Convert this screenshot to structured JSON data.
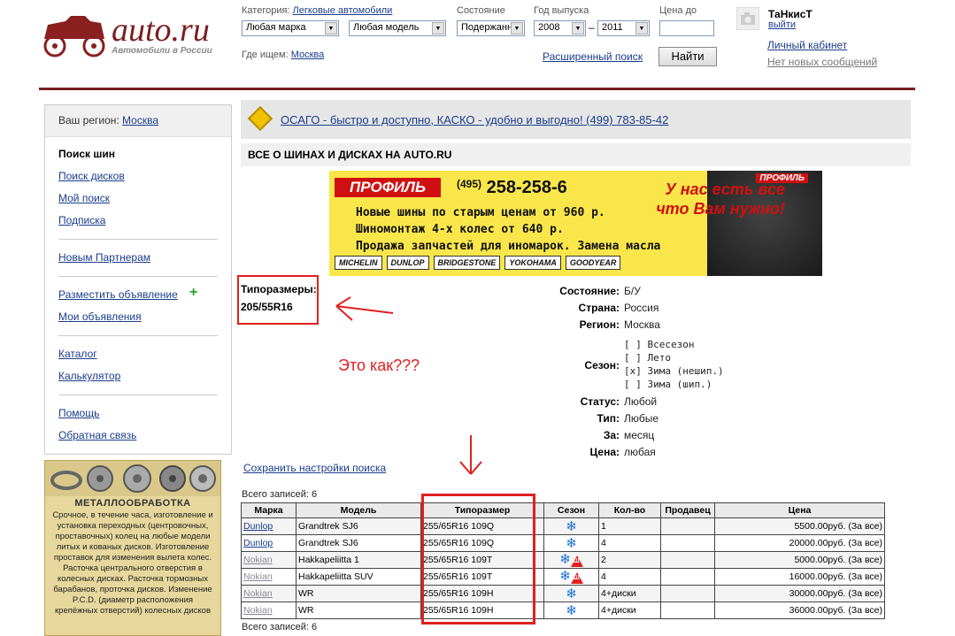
{
  "header": {
    "logo_text": "auto.ru",
    "logo_subtitle": "Автомобили в России",
    "category_label": "Категория:",
    "category_value": "Легковые автомобили",
    "make_value": "Любая марка",
    "model_value": "Любая модель",
    "condition_label": "Состояние",
    "condition_value": "Подержанн",
    "year_label": "Год выпуска",
    "year_from": "2008",
    "year_dash": "–",
    "year_to": "2011",
    "price_label": "Цена до",
    "price_value": "",
    "where_label": "Где ищем:",
    "where_value": "Москва",
    "advanced_search": "Расширенный поиск",
    "find_button": "Найти",
    "username": "ТаНкисТ",
    "logout": "выйти",
    "cabinet": "Личный кабинет",
    "messages": "Нет новых сообщений"
  },
  "sidebar": {
    "region_label": "Ваш регион:",
    "region_value": "Москва",
    "current_item": "Поиск шин",
    "items": [
      "Поиск дисков",
      "Мой поиск",
      "Подписка",
      "Новым Партнерам",
      "Разместить объявление",
      "Мои объявления",
      "Каталог",
      "Калькулятор",
      "Помощь",
      "Обратная связь"
    ],
    "plus": "+"
  },
  "ad_metal": {
    "title": "МЕТАЛЛООБРАБОТКА",
    "text": "Срочное, в течение часа, изготовление и установка переходных (центровочных, проставочных) колец на любые модели литых и кованых дисков. Изготовление проставок для изменения вылета колес. Расточка центрального отверстия в колесных дисках. Расточка тормозных барабанов, проточка дисков. Изменение P.C.D. (диаметр расположения крепёжных отверстий) колесных дисков"
  },
  "main": {
    "osago": "ОСАГО - быстро и доступно, КАСКО - удобно и выгодно! (499) 783-85-42",
    "section_title": "ВСЕ О ШИНАХ И ДИСКАХ НА AUTO.RU"
  },
  "banner": {
    "logo": "ПРОФИЛЬ",
    "logo2": "ПРОФИЛЬ",
    "phone_code": "(495)",
    "phone": "258-258-6",
    "slogan_1": "У нас есть все",
    "slogan_2": "что Вам нужно!",
    "line_1": "Новые шины по старым ценам от 960 р.",
    "line_2": "Шиномонтаж 4-х колес от 640 р.",
    "line_3": "Продажа запчастей для иномарок.  Замена масла",
    "brands": [
      "MICHELIN",
      "DUNLOP",
      "BRIDGESTONE",
      "YOKOHAMA",
      "GOODYEAR"
    ]
  },
  "annotations": {
    "tipo_label": "Типоразмеры:",
    "tipo_value": "205/55R16",
    "question": "Это как???"
  },
  "filters": {
    "condition_label": "Состояние:",
    "condition_value": "Б/У",
    "country_label": "Страна:",
    "country_value": "Россия",
    "region_label": "Регион:",
    "region_value": "Москва",
    "season_label": "Сезон:",
    "season_options": [
      "[ ] Всесезон",
      "[ ] Лето",
      "[x] Зима (нешип.)",
      "[ ] Зима (шип.)"
    ],
    "status_label": "Статус:",
    "status_value": "Любой",
    "type_label": "Тип:",
    "type_value": "Любые",
    "period_label": "За:",
    "period_value": "месяц",
    "price_label": "Цена:",
    "price_value": "любая",
    "save_link": "Сохранить настройки поиска"
  },
  "table": {
    "count_top": "Всего записей: 6",
    "count_bottom": "Всего записей: 6",
    "headers": [
      "Марка",
      "Модель",
      "Типоразмер",
      "Сезон",
      "Кол-во",
      "Продавец",
      "Цена"
    ],
    "rows": [
      {
        "make": "Dunlop",
        "model": "Grandtrek SJ6",
        "size": "255/65R16 109Q",
        "qty": "1",
        "seller": "",
        "price": "5500.00руб. (За все)",
        "studded": false
      },
      {
        "make": "Dunlop",
        "model": "Grandtrek SJ6",
        "size": "255/65R16 109Q",
        "qty": "4",
        "seller": "",
        "price": "20000.00руб. (За все)",
        "studded": false
      },
      {
        "make": "Nokian",
        "model": "Hakkapeliitta 1",
        "size": "255/65R16 109T",
        "qty": "2",
        "seller": "",
        "price": "5000.00руб. (За все)",
        "studded": true
      },
      {
        "make": "Nokian",
        "model": "Hakkapeliitta SUV",
        "size": "255/65R16 109T",
        "qty": "4",
        "seller": "",
        "price": "16000.00руб. (За все)",
        "studded": true
      },
      {
        "make": "Nokian",
        "model": "WR",
        "size": "255/65R16 109H",
        "qty": "4+диски",
        "seller": "",
        "price": "30000.00руб. (За все)",
        "studded": false
      },
      {
        "make": "Nokian",
        "model": "WR",
        "size": "255/65R16 109H",
        "qty": "4+диски",
        "seller": "",
        "price": "36000.00руб. (За все)",
        "studded": false
      }
    ],
    "snow_glyph": "❄",
    "stud_glyph": "Ш"
  }
}
